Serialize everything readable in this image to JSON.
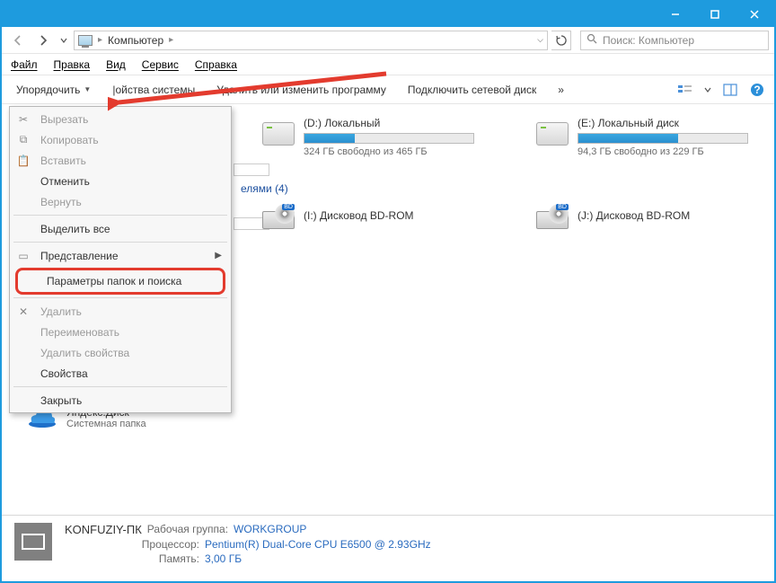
{
  "titlebar": {
    "minimize": "—",
    "maximize": "☐",
    "close": "✕"
  },
  "nav": {
    "breadcrumb": "Компьютер",
    "search_placeholder": "Поиск: Компьютер"
  },
  "menubar": {
    "file": "Файл",
    "edit": "Правка",
    "view": "Вид",
    "service": "Сервис",
    "help": "Справка"
  },
  "toolbar": {
    "organize": "Упорядочить",
    "system_props": "|ойства системы",
    "uninstall": "Удалить или изменить программу",
    "map_drive": "Подключить сетевой диск",
    "more": "»"
  },
  "dropdown": {
    "cut": "Вырезать",
    "copy": "Копировать",
    "paste": "Вставить",
    "undo": "Отменить",
    "redo": "Вернуть",
    "select_all": "Выделить все",
    "layout": "Представление",
    "folder_options": "Параметры папок и поиска",
    "delete": "Удалить",
    "rename": "Переименовать",
    "remove_props": "Удалить свойства",
    "properties": "Свойства",
    "close": "Закрыть"
  },
  "groups": {
    "removable_suffix": "елями (4)"
  },
  "drives": [
    {
      "name": "(D:) Локальный",
      "free": "324 ГБ свободно из 465 ГБ",
      "fill_pct": 30
    },
    {
      "name": "(E:) Локальный диск",
      "free": "94,3 ГБ свободно из 229 ГБ",
      "fill_pct": 59
    }
  ],
  "media": [
    {
      "name": "(I:) Дисковод BD-ROM"
    },
    {
      "name": "(J:) Дисковод BD-ROM"
    }
  ],
  "ydisk": {
    "title": "Яндекс.Диск",
    "subtitle": "Системная папка"
  },
  "status": {
    "computer_name": "KONFUZIY-ПК",
    "workgroup_label": "Рабочая группа:",
    "workgroup": "WORKGROUP",
    "cpu_label": "Процессор:",
    "cpu": "Pentium(R) Dual-Core  CPU      E6500   @ 2.93GHz",
    "mem_label": "Память:",
    "mem": "3,00 ГБ"
  }
}
